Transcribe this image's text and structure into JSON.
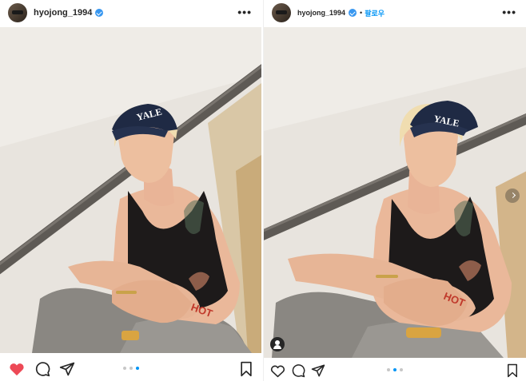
{
  "left_post": {
    "username": "hyojong_1994",
    "more_label": "•••",
    "carousel": {
      "count": 3,
      "active_index": 2
    }
  },
  "right_post": {
    "username": "hyojong_1994",
    "separator": "•",
    "follow_label": "팔로우",
    "more_label": "•••",
    "carousel": {
      "count": 3,
      "active_index": 1
    }
  },
  "photo": {
    "cap_text": "YALE",
    "tattoo_text": "HOT"
  },
  "colors": {
    "like_active": "#ed4956",
    "accent_blue": "#0095f6",
    "text": "#262626"
  },
  "icons": [
    "heart-icon",
    "comment-icon",
    "share-icon",
    "bookmark-icon",
    "verified-icon",
    "more-icon",
    "next-arrow-icon",
    "tagged-user-icon"
  ]
}
